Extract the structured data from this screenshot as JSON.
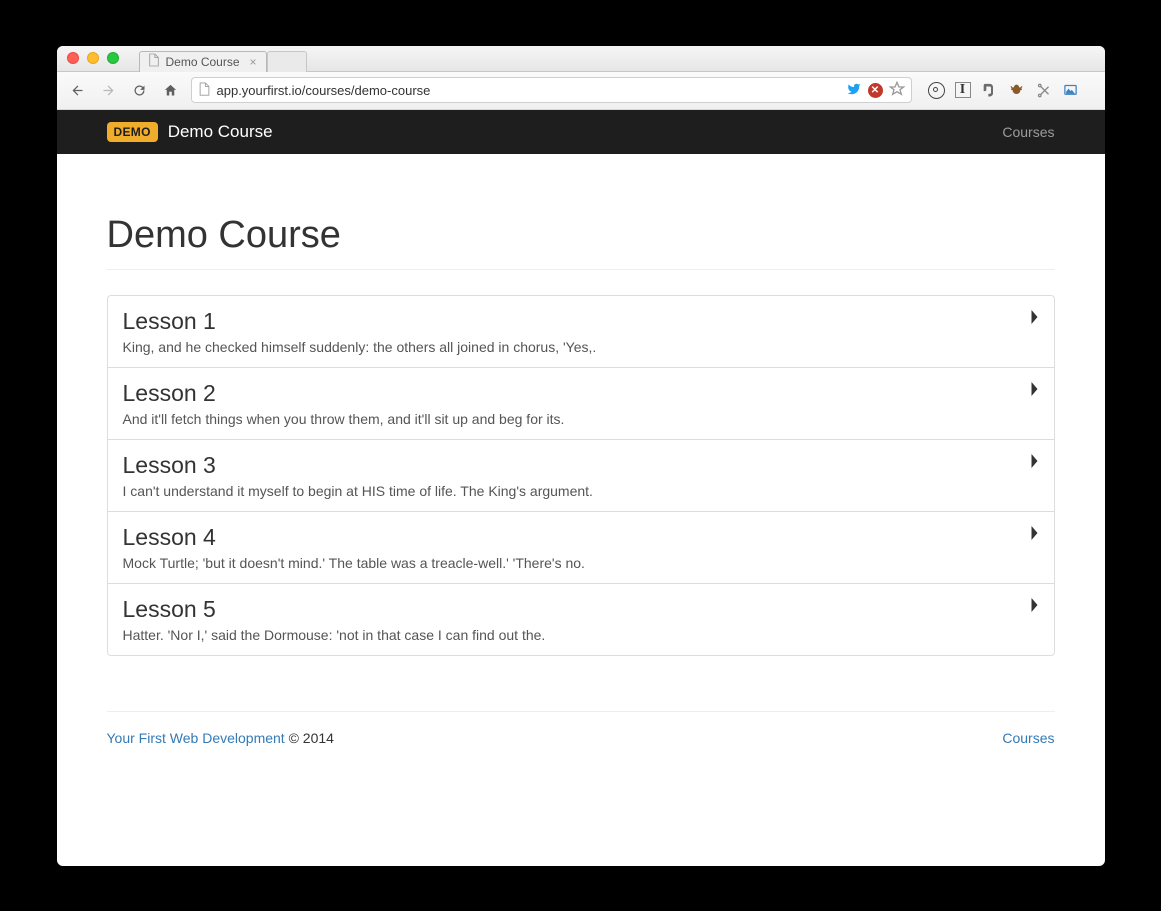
{
  "browser": {
    "tab_title": "Demo Course",
    "url": "app.yourfirst.io/courses/demo-course"
  },
  "nav": {
    "badge": "DEMO",
    "brand_title": "Demo Course",
    "right_link": "Courses"
  },
  "page": {
    "heading": "Demo Course"
  },
  "lessons": [
    {
      "title": "Lesson 1",
      "desc": "King, and he checked himself suddenly: the others all joined in chorus, 'Yes,."
    },
    {
      "title": "Lesson 2",
      "desc": "And it'll fetch things when you throw them, and it'll sit up and beg for its."
    },
    {
      "title": "Lesson 3",
      "desc": "I can't understand it myself to begin at HIS time of life. The King's argument."
    },
    {
      "title": "Lesson 4",
      "desc": "Mock Turtle; 'but it doesn't mind.' The table was a treacle-well.' 'There's no."
    },
    {
      "title": "Lesson 5",
      "desc": "Hatter. 'Nor I,' said the Dormouse: 'not in that case I can find out the."
    }
  ],
  "footer": {
    "left_link": "Your First Web Development",
    "copy": " © 2014",
    "right_link": "Courses"
  }
}
